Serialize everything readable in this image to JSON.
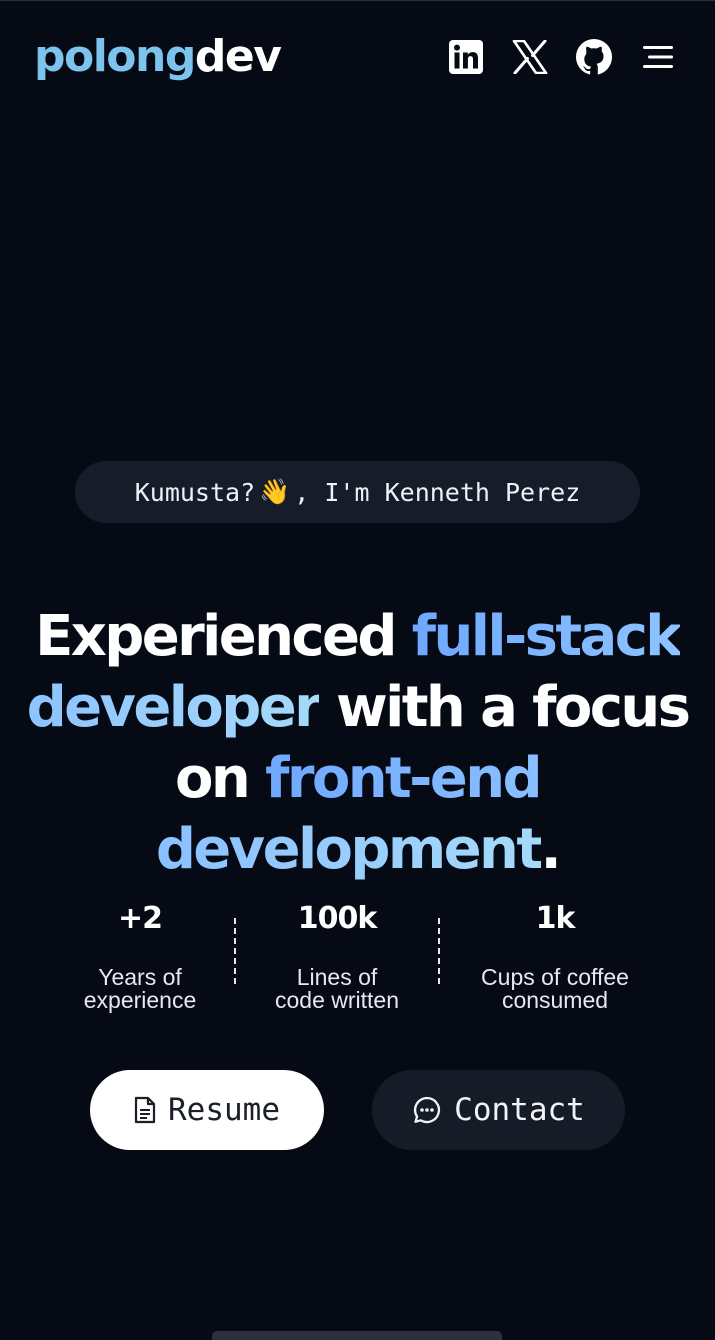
{
  "brand": {
    "logo_part_a": "polong",
    "logo_part_b": "dev",
    "logo_color": "#7cc4ee"
  },
  "header": {
    "icons": [
      "linkedin-icon",
      "x-icon",
      "github-icon",
      "menu-icon"
    ]
  },
  "hero": {
    "greeting": {
      "before": "Kumusta?",
      "emoji": "👋",
      "after": ", I'm Kenneth Perez"
    },
    "headline": {
      "w1": "Experienced",
      "g1": "full-stack developer",
      "w2": "with a focus on",
      "g2": "front-end development",
      "end": "."
    },
    "accent_gradient": [
      "#6ea8ff",
      "#a6dafa"
    ]
  },
  "stats": [
    {
      "value": "+2",
      "label": "Years of\nexperience"
    },
    {
      "value": "100k",
      "label": "Lines of\ncode written"
    },
    {
      "value": "1k",
      "label": "Cups of coffee\nconsumed"
    }
  ],
  "actions": {
    "resume_label": "Resume",
    "resume_icon": "document-icon",
    "contact_label": "Contact",
    "contact_icon": "chat-bubble-icon"
  },
  "colors": {
    "background": "#050a14",
    "pill_background": "#161c29"
  }
}
